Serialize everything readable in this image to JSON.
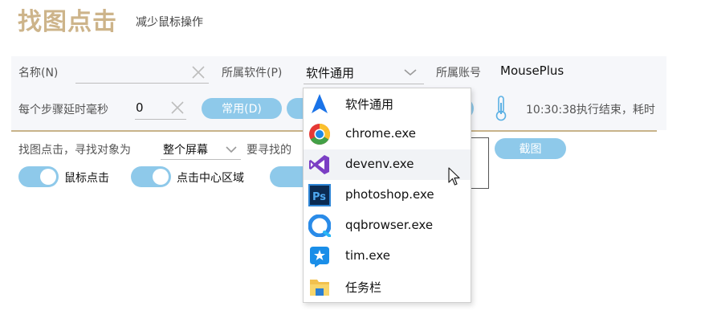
{
  "header": {
    "title": "找图点击",
    "subtitle": "减少鼠标操作"
  },
  "row1": {
    "name_label": "名称(N)",
    "name_value": "",
    "software_label": "所属软件(P)",
    "software_value": "软件通用",
    "account_label": "所属账号",
    "account_value": "MousePlus"
  },
  "row2": {
    "delay_label": "每个步骤延时毫秒",
    "delay_value": "0",
    "common_button": "常用(D)",
    "status_text": "10:30:38执行结束，耗时"
  },
  "row3": {
    "find_label": "找图点击，寻找对象为",
    "target_value": "整个屏幕",
    "image_label": "要寻找的",
    "screenshot_button": "截图"
  },
  "toggles": [
    {
      "label": "鼠标点击",
      "on": true
    },
    {
      "label": "点击中心区域",
      "on": true
    }
  ],
  "dropdown": {
    "items": [
      {
        "label": "软件通用",
        "icon": "arrow-icon"
      },
      {
        "label": "chrome.exe",
        "icon": "chrome-icon"
      },
      {
        "label": "devenv.exe",
        "icon": "visual-studio-icon"
      },
      {
        "label": "photoshop.exe",
        "icon": "photoshop-icon"
      },
      {
        "label": "qqbrowser.exe",
        "icon": "qqbrowser-icon"
      },
      {
        "label": "tim.exe",
        "icon": "tim-icon"
      },
      {
        "label": "任务栏",
        "icon": "folder-icon"
      }
    ]
  },
  "colors": {
    "accent": "#8ec9ea",
    "title": "#cdb48a"
  }
}
